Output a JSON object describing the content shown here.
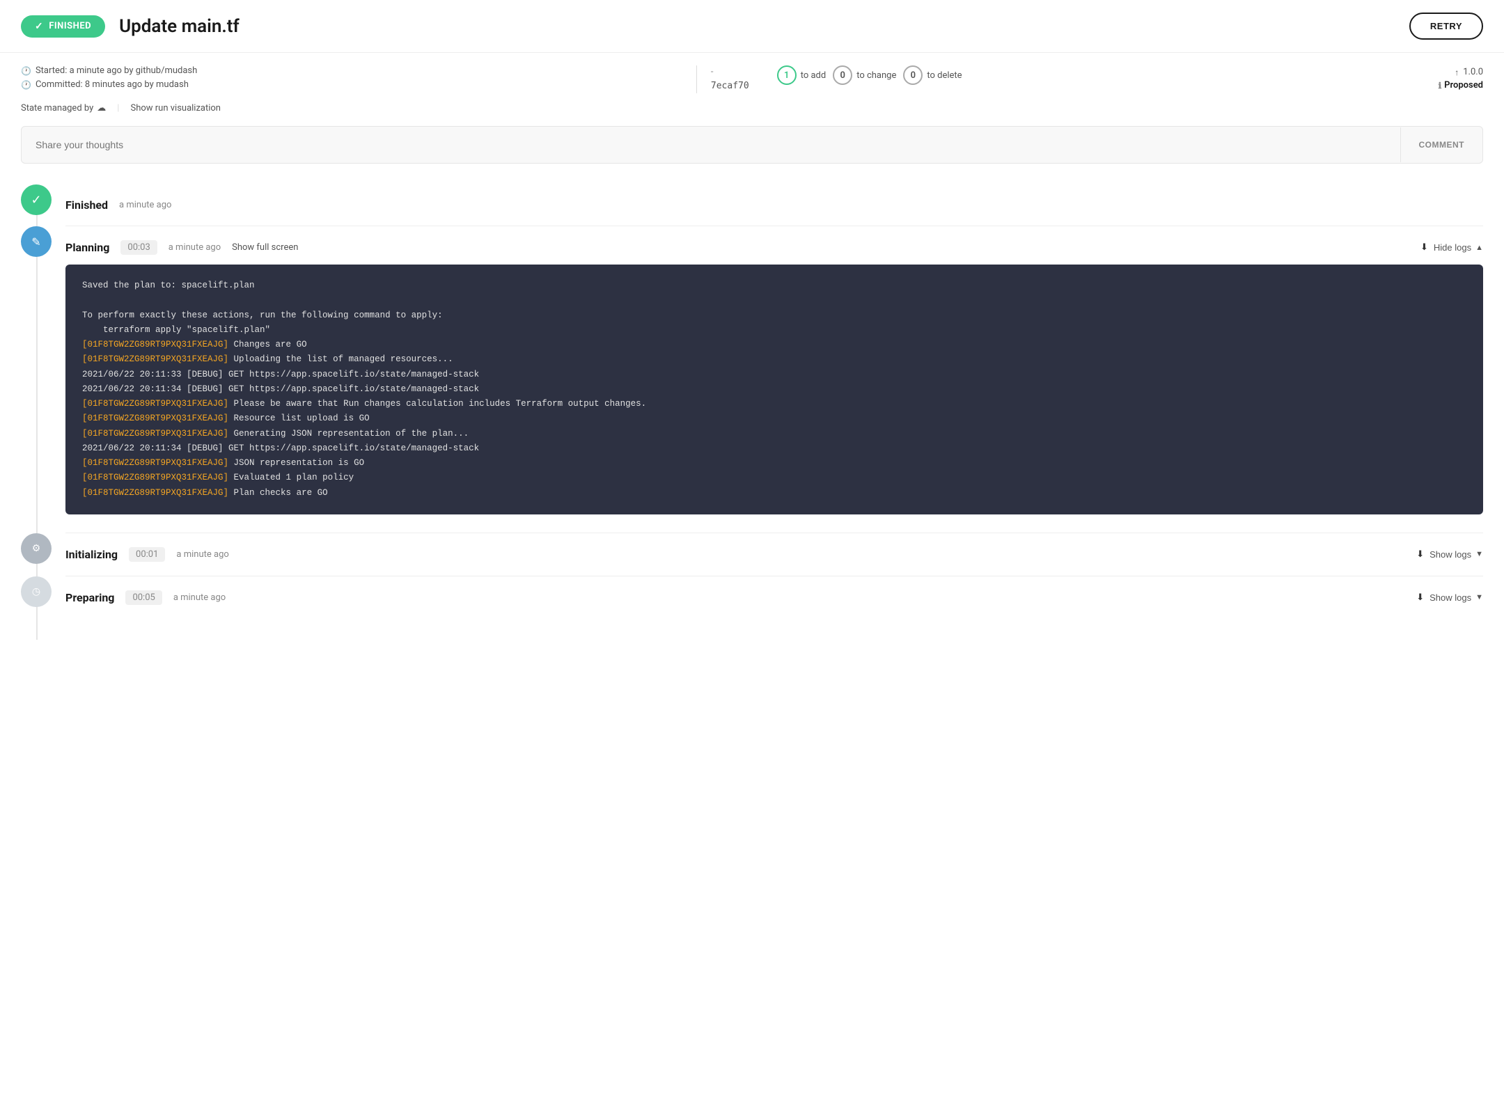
{
  "header": {
    "status_label": "FINISHED",
    "title": "Update main.tf",
    "retry_label": "RETRY"
  },
  "meta": {
    "started_label": "Started: a minute ago by github/mudash",
    "committed_label": "Committed: 8 minutes ago by mudash",
    "separator": "-",
    "commit_hash": "7ecaf70",
    "changes": {
      "add_count": "1",
      "add_label": "to add",
      "change_count": "0",
      "change_label": "to change",
      "delete_count": "0",
      "delete_label": "to delete"
    },
    "version": "↑ 1.0.0",
    "proposed_label": "Proposed"
  },
  "state_row": {
    "state_label": "State managed by",
    "viz_label": "Show run visualization"
  },
  "comment": {
    "placeholder": "Share your thoughts",
    "button_label": "COMMENT"
  },
  "timeline": {
    "items": [
      {
        "id": "finished",
        "name": "Finished",
        "time": "a minute ago",
        "circle_type": "green",
        "circle_icon": "✓"
      },
      {
        "id": "planning",
        "name": "Planning",
        "duration": "00:03",
        "time": "a minute ago",
        "show_screen_label": "Show full screen",
        "logs_label": "Hide logs",
        "circle_type": "blue",
        "circle_icon": "✎",
        "has_logs": true
      },
      {
        "id": "initializing",
        "name": "Initializing",
        "duration": "00:01",
        "time": "a minute ago",
        "logs_label": "Show logs",
        "circle_type": "gray",
        "circle_icon": "⚙",
        "has_logs": false
      },
      {
        "id": "preparing",
        "name": "Preparing",
        "duration": "00:05",
        "time": "a minute ago",
        "logs_label": "Show logs",
        "circle_type": "light-gray",
        "circle_icon": "◷",
        "has_logs": false
      }
    ]
  },
  "logs": {
    "lines": [
      {
        "type": "normal",
        "text": "Saved the plan to: spacelift.plan"
      },
      {
        "type": "normal",
        "text": ""
      },
      {
        "type": "normal",
        "text": "To perform exactly these actions, run the following command to apply:"
      },
      {
        "type": "normal",
        "text": "    terraform apply \"spacelift.plan\""
      },
      {
        "type": "highlight",
        "prefix": "[01F8TGW2ZG89RT9PXQ31FXEAJG]",
        "text": " Changes are GO"
      },
      {
        "type": "highlight",
        "prefix": "[01F8TGW2ZG89RT9PXQ31FXEAJG]",
        "text": " Uploading the list of managed resources..."
      },
      {
        "type": "normal",
        "text": "2021/06/22 20:11:33 [DEBUG] GET https://app.spacelift.io/state/managed-stack"
      },
      {
        "type": "normal",
        "text": "2021/06/22 20:11:34 [DEBUG] GET https://app.spacelift.io/state/managed-stack"
      },
      {
        "type": "highlight",
        "prefix": "[01F8TGW2ZG89RT9PXQ31FXEAJG]",
        "text": " Please be aware that Run changes calculation includes Terraform output changes."
      },
      {
        "type": "highlight",
        "prefix": "[01F8TGW2ZG89RT9PXQ31FXEAJG]",
        "text": " Resource list upload is GO"
      },
      {
        "type": "highlight",
        "prefix": "[01F8TGW2ZG89RT9PXQ31FXEAJG]",
        "text": " Generating JSON representation of the plan..."
      },
      {
        "type": "normal",
        "text": "2021/06/22 20:11:34 [DEBUG] GET https://app.spacelift.io/state/managed-stack"
      },
      {
        "type": "highlight",
        "prefix": "[01F8TGW2ZG89RT9PXQ31FXEAJG]",
        "text": " JSON representation is GO"
      },
      {
        "type": "highlight",
        "prefix": "[01F8TGW2ZG89RT9PXQ31FXEAJG]",
        "text": " Evaluated 1 plan policy"
      },
      {
        "type": "highlight",
        "prefix": "[01F8TGW2ZG89RT9PXQ31FXEAJG]",
        "text": " Plan checks are GO"
      }
    ]
  }
}
